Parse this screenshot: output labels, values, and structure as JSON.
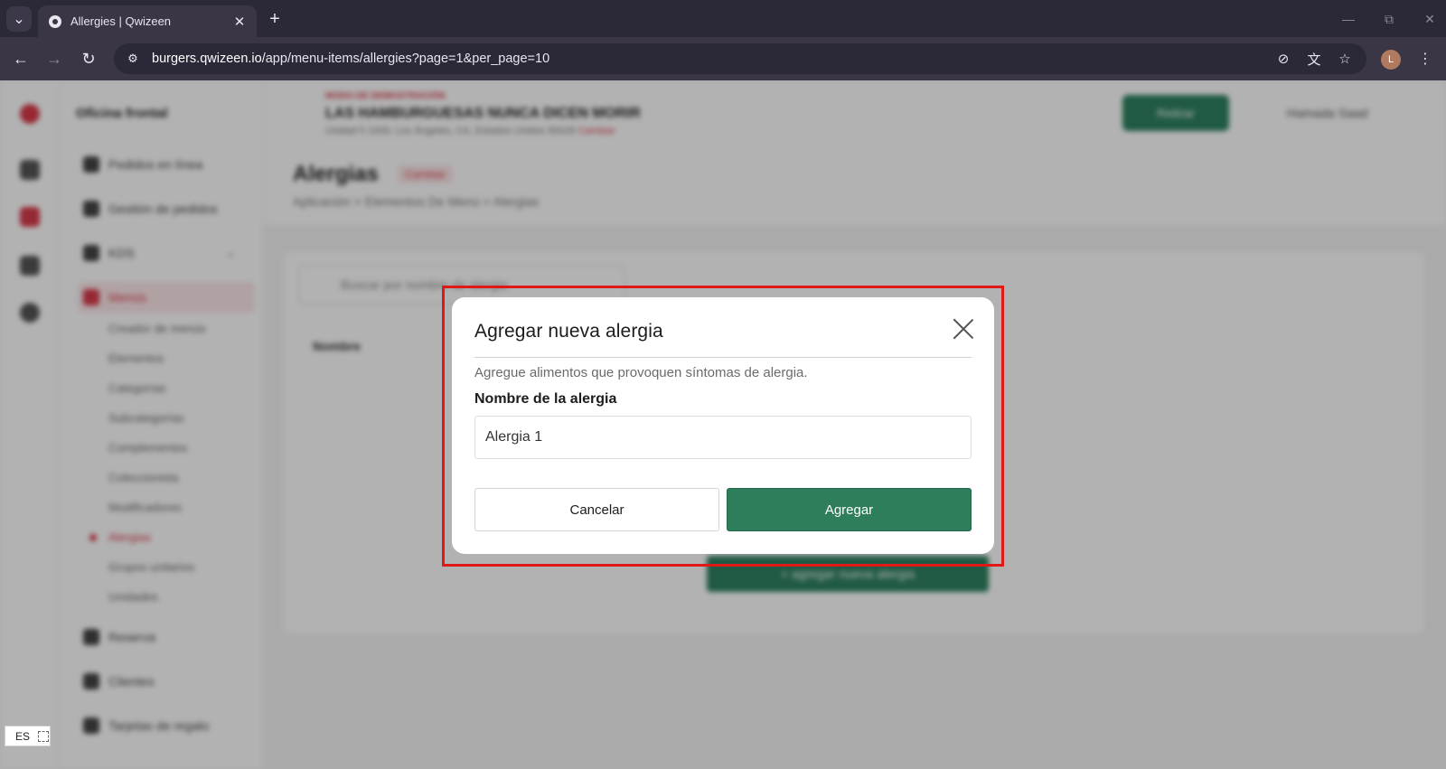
{
  "browser": {
    "tab_title": "Allergies | Qwizeen",
    "url_host": "burgers.qwizeen.io",
    "url_path": "/app/menu-items/allergies?page=1&per_page=10",
    "profile_initial": "L"
  },
  "background": {
    "sidebar_title": "Oficina frontal",
    "sidebar_items": [
      {
        "label": "Pedidos en línea"
      },
      {
        "label": "Gestión de pedidos"
      },
      {
        "label": "KDS"
      },
      {
        "label": "Menús"
      },
      {
        "label": "Reserva"
      },
      {
        "label": "Clientes"
      },
      {
        "label": "Tarjetas de regalo"
      }
    ],
    "sidebar_subitems": [
      {
        "label": "Creador de menús"
      },
      {
        "label": "Elementos"
      },
      {
        "label": "Categorías"
      },
      {
        "label": "Subcategorías"
      },
      {
        "label": "Complementos"
      },
      {
        "label": "Coleccionista"
      },
      {
        "label": "Modificadores"
      },
      {
        "label": "Alergias"
      },
      {
        "label": "Grupos unitarios"
      },
      {
        "label": "Unidades"
      }
    ],
    "header_small": "MODO DE DEMOSTRACIÓN",
    "store_name": "LAS HAMBURGUESAS NUNCA DICEN MORIR",
    "store_address": "Unidad 5 1000, Los Ángeles, CA, Estados Unidos 90028",
    "store_address_link": "Cambiar",
    "header_button": "Retirar",
    "header_user": "Hamada Saad",
    "page_title": "Alergias",
    "page_badge": "Cambiar",
    "breadcrumb": "Aplicación  >  Elementos De Menú  >  Alergias",
    "search_placeholder": "Buscar por nombre de alergia",
    "column_name": "Nombre",
    "add_button": "+ agregar nueva alergia"
  },
  "modal": {
    "title": "Agregar nueva alergia",
    "description": "Agregue alimentos que provoquen síntomas de alergia.",
    "field_label": "Nombre de la alergia",
    "field_value": "Alergia 1",
    "cancel_label": "Cancelar",
    "submit_label": "Agregar"
  },
  "language_widget": {
    "code": "ES"
  },
  "colors": {
    "accent_green": "#2e7d5b",
    "brand_red": "#d83a4a",
    "highlight_red": "#e01818"
  }
}
